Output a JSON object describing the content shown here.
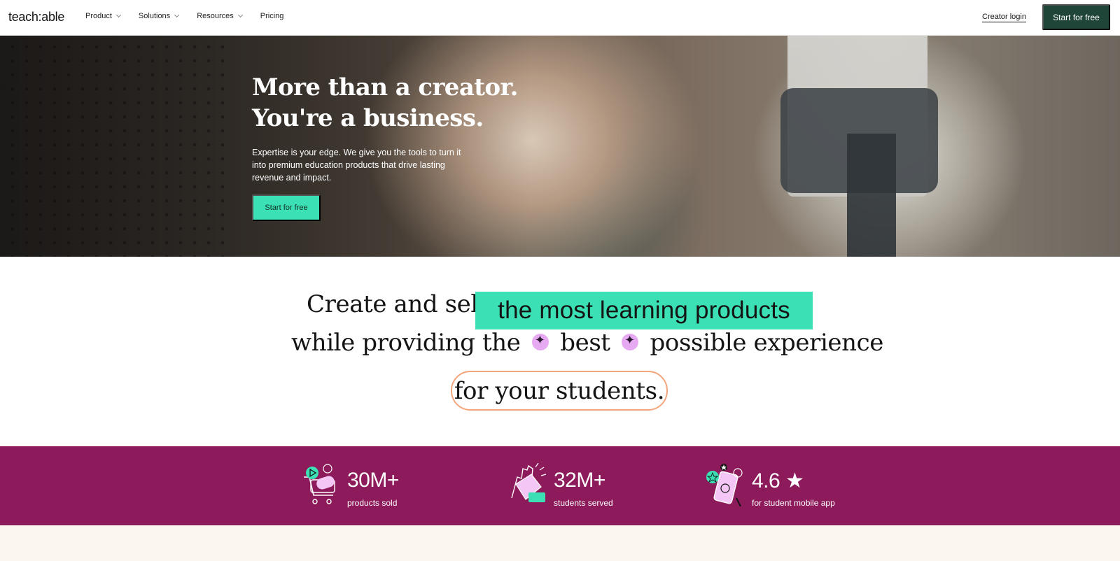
{
  "nav": {
    "logo": "teach:able",
    "items": [
      {
        "label": "Product",
        "dropdown": true
      },
      {
        "label": "Solutions",
        "dropdown": true
      },
      {
        "label": "Resources",
        "dropdown": true
      },
      {
        "label": "Pricing",
        "dropdown": false
      }
    ],
    "login_label": "Creator login",
    "cta_label": "Start for free"
  },
  "hero": {
    "title_line1": "More than a creator.",
    "title_line2": "You're a business.",
    "subtitle": "Expertise is your edge. We give you the tools to turn it into premium education products that drive lasting revenue and impact.",
    "cta_label": "Start for free"
  },
  "statement": {
    "line1_prefix": "Create and sell",
    "line1_highlight": "the most learning products",
    "line2_a": "while providing the",
    "line2_b": "best",
    "line2_c": "possible experience",
    "line3": "for your students."
  },
  "stats": [
    {
      "value": "30M+",
      "label": "products sold",
      "icon": "shopping-cart-icon"
    },
    {
      "value": "32M+",
      "label": "students served",
      "icon": "clapping-hands-icon"
    },
    {
      "value": "4.6 ★",
      "label": "for student mobile app",
      "icon": "mobile-app-icon"
    }
  ],
  "colors": {
    "brand_dark": "#1f4538",
    "accent_mint": "#3be0b4",
    "stats_bg": "#8d1a5b",
    "outline_peach": "#f3a57c",
    "sparkle_pink": "#e7a9f2",
    "cream": "#fbf7ee"
  }
}
